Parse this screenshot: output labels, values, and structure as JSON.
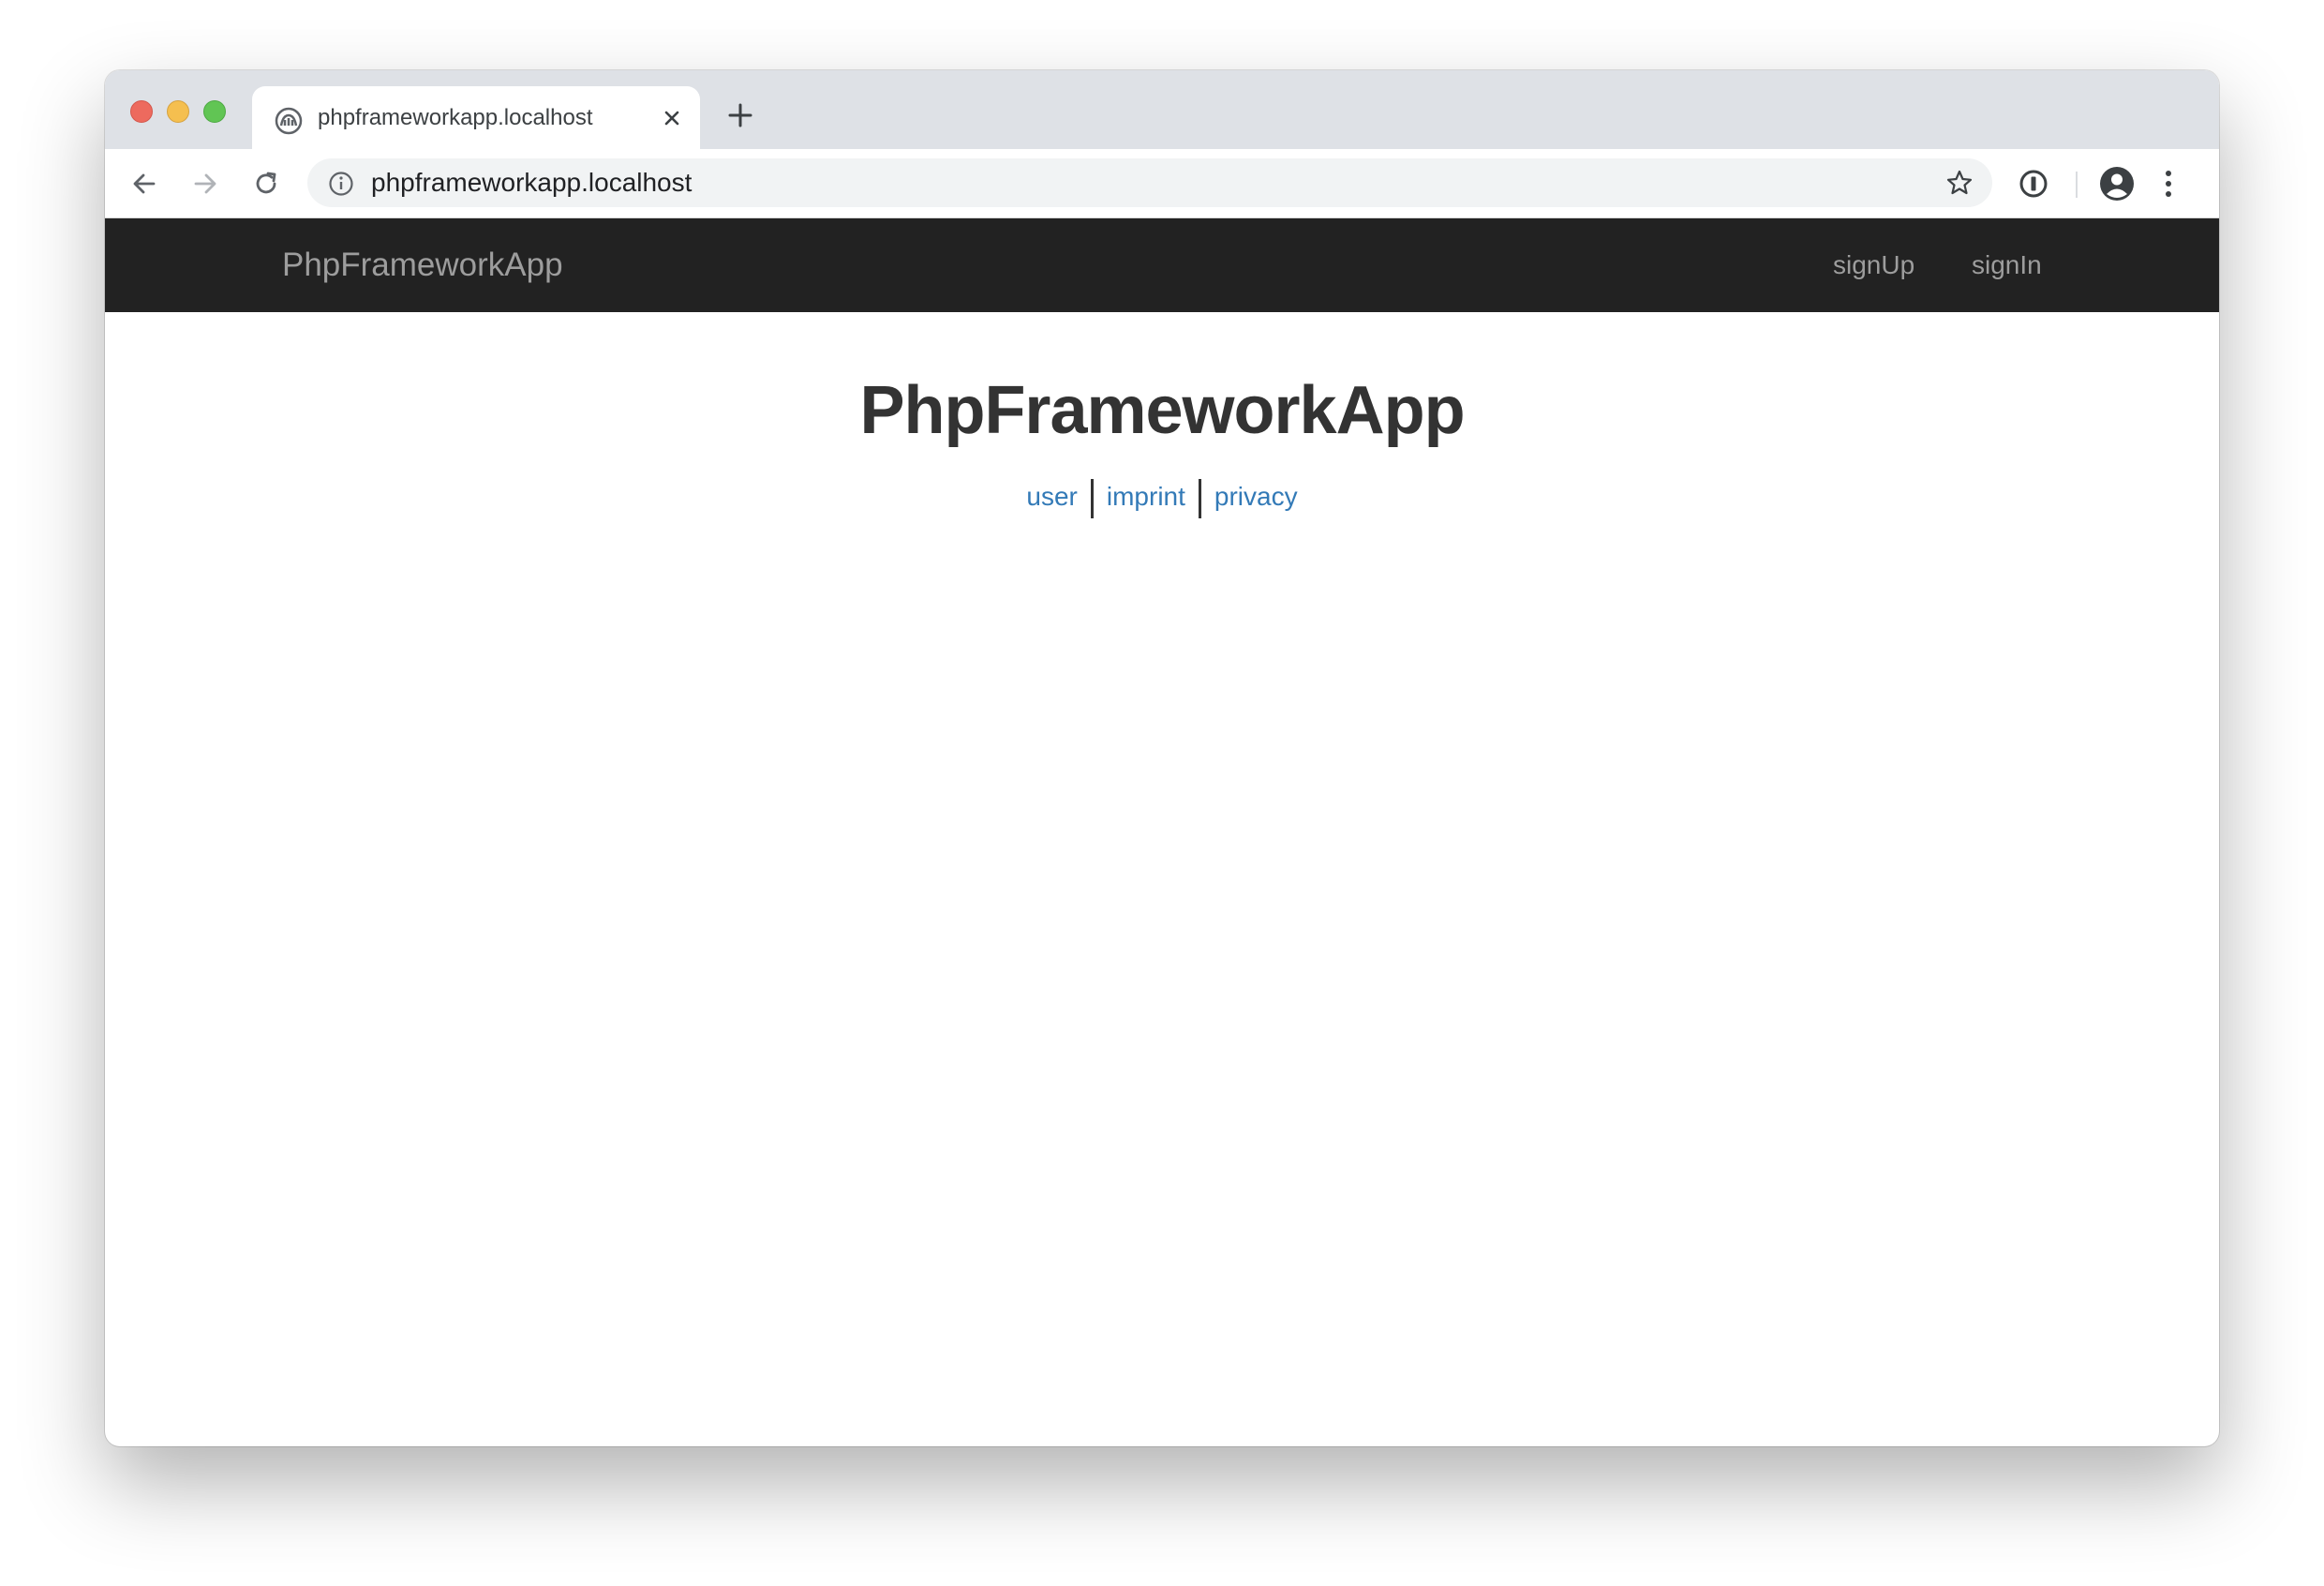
{
  "browser": {
    "tab_title": "phpframeworkapp.localhost",
    "url": "phpframeworkapp.localhost",
    "icons": {
      "back": "arrow-left-icon",
      "forward": "arrow-right-icon",
      "reload": "reload-icon",
      "info": "info-icon",
      "bookmark": "star-icon",
      "extension": "password-manager-icon",
      "profile": "account-circle-icon",
      "menu": "kebab-menu-icon",
      "new_tab": "plus-icon",
      "close_tab": "close-icon"
    }
  },
  "navbar": {
    "brand": "PhpFrameworkApp",
    "links": [
      {
        "label": "signUp"
      },
      {
        "label": "signIn"
      }
    ]
  },
  "main": {
    "title": "PhpFrameworkApp",
    "links": [
      {
        "label": "user"
      },
      {
        "label": "imprint"
      },
      {
        "label": "privacy"
      }
    ]
  },
  "colors": {
    "navbar_bg": "#222222",
    "navbar_text": "#9d9d9d",
    "link": "#337ab7",
    "heading": "#333333"
  }
}
